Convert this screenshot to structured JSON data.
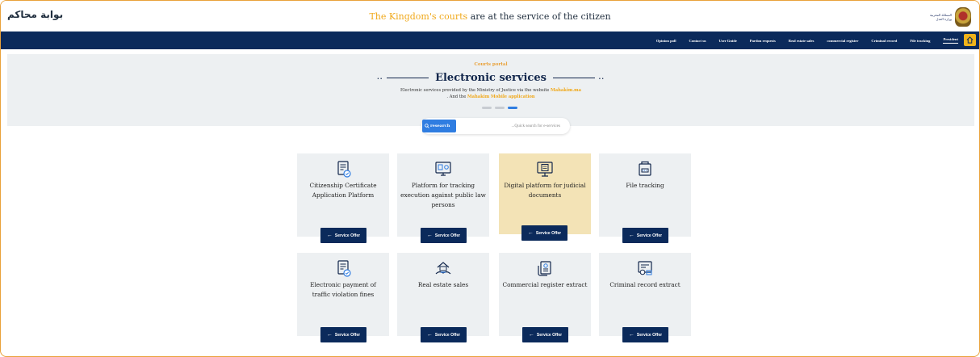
{
  "header": {
    "logo_text": "بوابة محاكم",
    "tagline_highlight": "The Kingdom's courts",
    "tagline_rest": " are at the service of the citizen",
    "emblem_text": "المملكة المغربية وزارة العدل"
  },
  "nav": {
    "items": [
      "Opinion poll",
      "Contact us",
      "User Guide",
      "Pardon requests",
      "Real estate sales",
      "commercial register",
      "Criminal record",
      "File tracking",
      "President"
    ],
    "active_index": 8,
    "home_icon": "home-icon"
  },
  "hero": {
    "subtitle": "Courts portal",
    "title": "Electronic services",
    "desc_line1_prefix": "Electronic services provided by the Ministry of Justice via the website ",
    "desc_line1_link": "Mahakim.ma",
    "desc_line2_prefix": ". And the ",
    "desc_line2_link": "Mahakim Mobile application",
    "slides": 3,
    "active_slide": 3
  },
  "search": {
    "button_label": "research",
    "placeholder": "...Quick search for e-services"
  },
  "cards": [
    {
      "title": "Citizenship Certificate Application Platform",
      "icon": "certificate-icon",
      "button": "Service Offer",
      "highlighted": false
    },
    {
      "title": "Platform for tracking execution against public law persons",
      "icon": "monitor-tracking-icon",
      "button": "Service Offer",
      "highlighted": false
    },
    {
      "title": "Digital platform for judicial documents",
      "icon": "digital-documents-icon",
      "button": "Service Offer",
      "highlighted": true
    },
    {
      "title": "File tracking",
      "icon": "file-tracking-icon",
      "button": "Service Offer",
      "highlighted": false
    },
    {
      "title": "Electronic payment of traffic violation fines",
      "icon": "payment-certificate-icon",
      "button": "Service Offer",
      "highlighted": false
    },
    {
      "title": "Real estate sales",
      "icon": "real-estate-icon",
      "button": "Service Offer",
      "highlighted": false
    },
    {
      "title": "Commercial register extract",
      "icon": "register-extract-icon",
      "button": "Service Offer",
      "highlighted": false
    },
    {
      "title": "Criminal record extract",
      "icon": "criminal-record-icon",
      "button": "Service Offer",
      "highlighted": false
    }
  ],
  "colors": {
    "navy": "#0b2a5b",
    "accent": "#f0a819",
    "blue": "#2f7de1",
    "card_bg": "#edf0f2",
    "card_highlight": "#f3e3b6"
  }
}
